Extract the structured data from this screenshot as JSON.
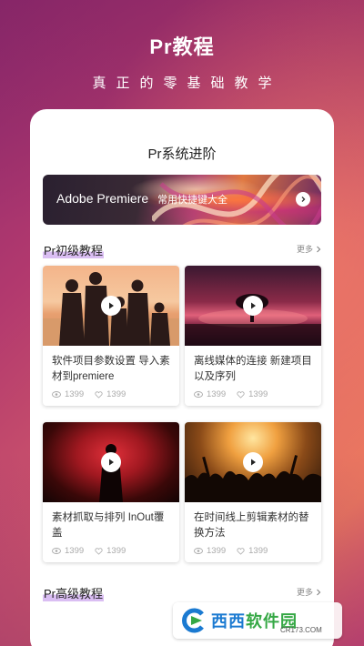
{
  "header": {
    "title": "Pr教程",
    "subtitle": "真正的零基础教学"
  },
  "card": {
    "title": "Pr系统进阶",
    "banner": {
      "title": "Adobe Premiere",
      "subtitle": "常用快捷键大全",
      "arrow_icon": "chevron-right-icon"
    }
  },
  "sections": [
    {
      "title": "Pr初级教程",
      "more_label": "更多",
      "items": [
        {
          "title": "软件项目参数设置 导入素材到premiere",
          "views": "1399",
          "likes": "1399"
        },
        {
          "title": "离线媒体的连接 新建项目以及序列",
          "views": "1399",
          "likes": "1399"
        },
        {
          "title": "素材抓取与排列 InOut覆盖",
          "views": "1399",
          "likes": "1399"
        },
        {
          "title": "在时间线上剪辑素材的替换方法",
          "views": "1399",
          "likes": "1399"
        }
      ]
    },
    {
      "title": "Pr高级教程",
      "more_label": "更多"
    }
  ],
  "watermark": {
    "brand": "西西",
    "brand_suffix": "软件园",
    "url": "CR173.COM"
  },
  "colors": {
    "section_highlight": "#9646dc",
    "background_start": "#8e2a6f",
    "background_end": "#e9765d"
  }
}
